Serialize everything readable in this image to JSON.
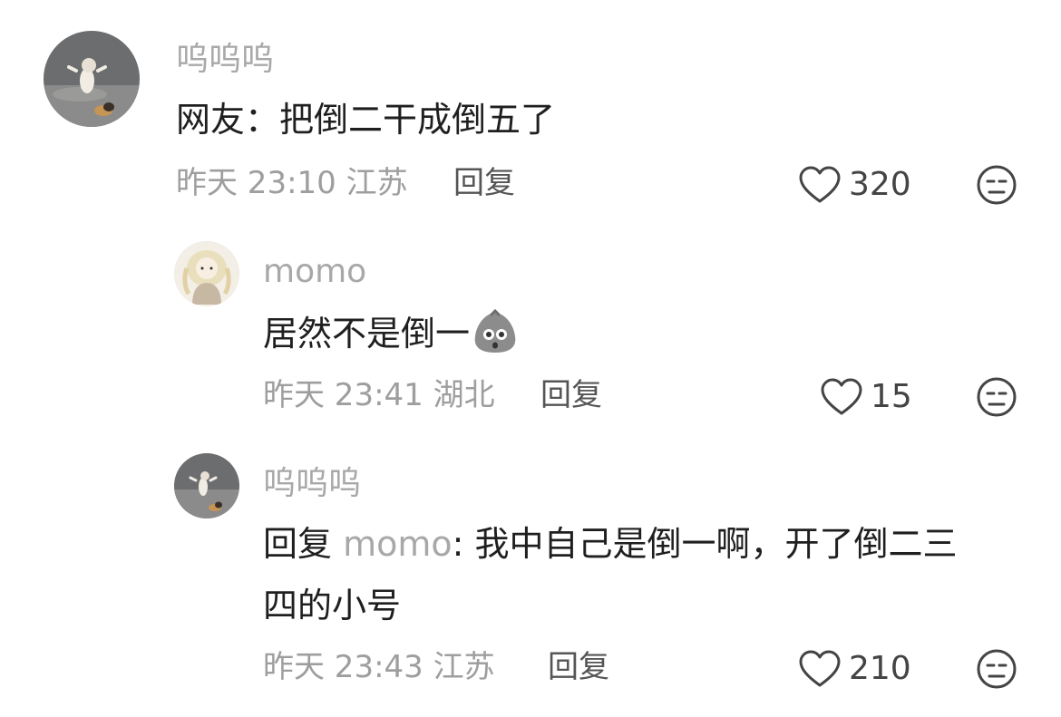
{
  "comments": [
    {
      "username": "呜呜呜",
      "text": "网友：把倒二干成倒五了",
      "time": "昨天 23:10",
      "location": "江苏",
      "reply_label": "回复",
      "likes": "320",
      "avatar_icon": "cat-photo-avatar"
    },
    {
      "username": "momo",
      "text": "居然不是倒一",
      "emoji": "potato-emoji",
      "time": "昨天 23:41",
      "location": "湖北",
      "reply_label": "回复",
      "likes": "15",
      "avatar_icon": "anime-girl-avatar"
    },
    {
      "username": "呜呜呜",
      "reply_prefix": "回复",
      "reply_to": "momo",
      "text_line1": ": 我中自己是倒一啊，开了倒二三",
      "text_line2": "四的小号",
      "time": "昨天 23:43",
      "location": "江苏",
      "reply_label": "回复",
      "likes": "210",
      "avatar_icon": "cat-photo-avatar"
    }
  ],
  "icons": {
    "like": "heart-outline-icon",
    "dislike": "unamused-face-icon"
  },
  "colors": {
    "username": "#a8a8a8",
    "content": "#1f1f1f",
    "meta": "#9e9e9e",
    "icon": "#444444"
  }
}
